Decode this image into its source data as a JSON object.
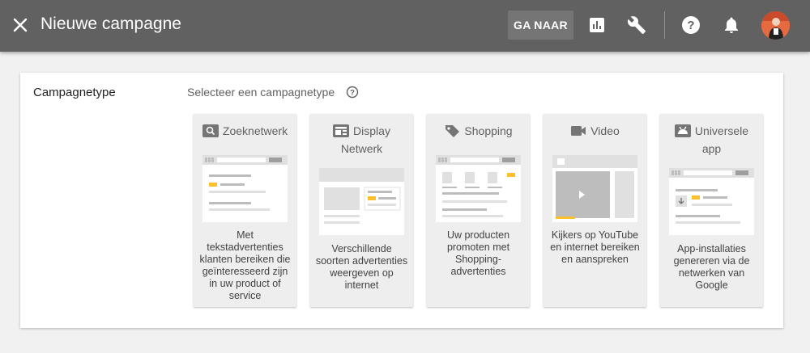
{
  "header": {
    "title": "Nieuwe campagne",
    "goto_label": "GA NAAR",
    "colors": {
      "bar": "#616161",
      "button": "#757575"
    },
    "icons": [
      "close-icon",
      "reports-icon",
      "tools-icon",
      "help-icon",
      "notifications-icon",
      "avatar"
    ]
  },
  "main": {
    "section_label": "Campagnetype",
    "prompt": "Selecteer een campagnetype",
    "options": [
      {
        "title": "Zoeknetwerk",
        "icon": "search-icon",
        "description": "Met tekstadvertenties klanten bereiken die geïnteresseerd zijn in uw product of service"
      },
      {
        "title": "Display Netwerk",
        "icon": "display-icon",
        "description": "Verschillende soorten advertenties weergeven op internet"
      },
      {
        "title": "Shopping",
        "icon": "tag-icon",
        "description": "Uw producten promoten met Shopping-advertenties"
      },
      {
        "title": "Video",
        "icon": "video-icon",
        "description": "Kijkers op YouTube en internet bereiken en aanspreken"
      },
      {
        "title": "Universele app",
        "icon": "app-icon",
        "description": "App-installaties genereren via de netwerken van Google"
      }
    ]
  }
}
